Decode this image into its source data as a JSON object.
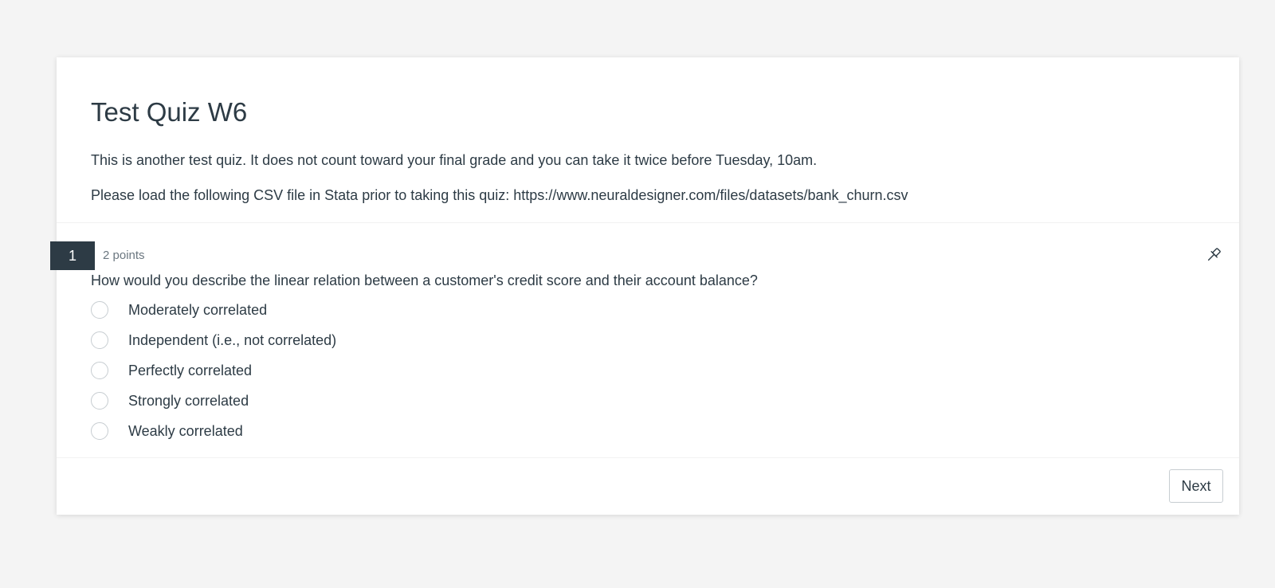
{
  "quiz": {
    "title": "Test Quiz W6",
    "description_line1": "This is another test quiz. It does not count toward your final grade and you can take it twice before Tuesday, 10am.",
    "description_line2": "Please load the following CSV file in Stata prior to taking this quiz: https://www.neuraldesigner.com/files/datasets/bank_churn.csv"
  },
  "question": {
    "number": "1",
    "points": "2 points",
    "pin_icon": "pin-icon",
    "text": "How would you describe the linear relation between a customer's credit score and their account balance?",
    "answers": [
      {
        "label": "Moderately correlated"
      },
      {
        "label": "Independent (i.e., not correlated)"
      },
      {
        "label": "Perfectly correlated"
      },
      {
        "label": "Strongly correlated"
      },
      {
        "label": "Weakly correlated"
      }
    ]
  },
  "footer": {
    "next_label": "Next"
  },
  "colors": {
    "page_background": "#f4f4f4",
    "card_background": "#ffffff",
    "text": "#2d3b45",
    "question_badge": "#2d3b45",
    "muted_text": "#6b7780",
    "border": "#c7cdd1"
  }
}
